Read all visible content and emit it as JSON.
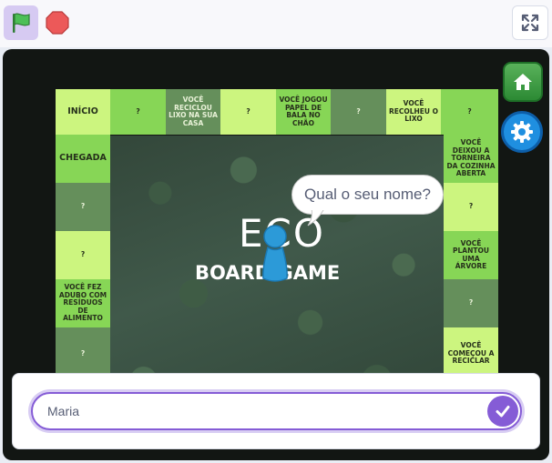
{
  "toolbar": {
    "green_flag_icon": "green-flag-icon",
    "stop_icon": "stop-sign-icon",
    "fullscreen_icon": "fullscreen-icon",
    "colors": {
      "flag_bg": "#d6caf2",
      "flag": "#4cbf56",
      "stop": "#ec5959"
    }
  },
  "board": {
    "cells": [
      {
        "text": "INÍCIO"
      },
      {
        "text": "?"
      },
      {
        "text": "VOCÊ RECICLOU LIXO NA SUA CASA"
      },
      {
        "text": "?"
      },
      {
        "text": "VOCÊ JOGOU PAPEL DE BALA NO CHÃO"
      },
      {
        "text": "?"
      },
      {
        "text": "VOCÊ RECOLHEU O LIXO"
      },
      {
        "text": "?"
      },
      {
        "text": "CHEGADA"
      },
      {
        "text": "?"
      },
      {
        "text": "?"
      },
      {
        "text": "VOCÊ FEZ ADUBO COM RESÍDUOS DE ALIMENTO"
      },
      {
        "text": "?"
      },
      {
        "text": "VOCÊ DEIXOU A TORNEIRA DA COZINHA ABERTA"
      },
      {
        "text": "?"
      },
      {
        "text": "VOCÊ PLANTOU UMA ÁRVORE"
      },
      {
        "text": "?"
      },
      {
        "text": "VOCÊ COMEÇOU A RECICLAR"
      }
    ],
    "colors": {
      "light": "#ccf57f",
      "mid": "#87d656",
      "dark": "#658f5b"
    }
  },
  "logo": {
    "line1": "ECO",
    "line2": "BOARD GAME"
  },
  "speech_bubble": {
    "text": "Qual o seu nome?"
  },
  "side_buttons": {
    "home_icon": "home-icon",
    "settings_icon": "gear-icon"
  },
  "ask": {
    "value": "Maria",
    "accent": "#855cd6",
    "check_icon": "check-icon"
  }
}
